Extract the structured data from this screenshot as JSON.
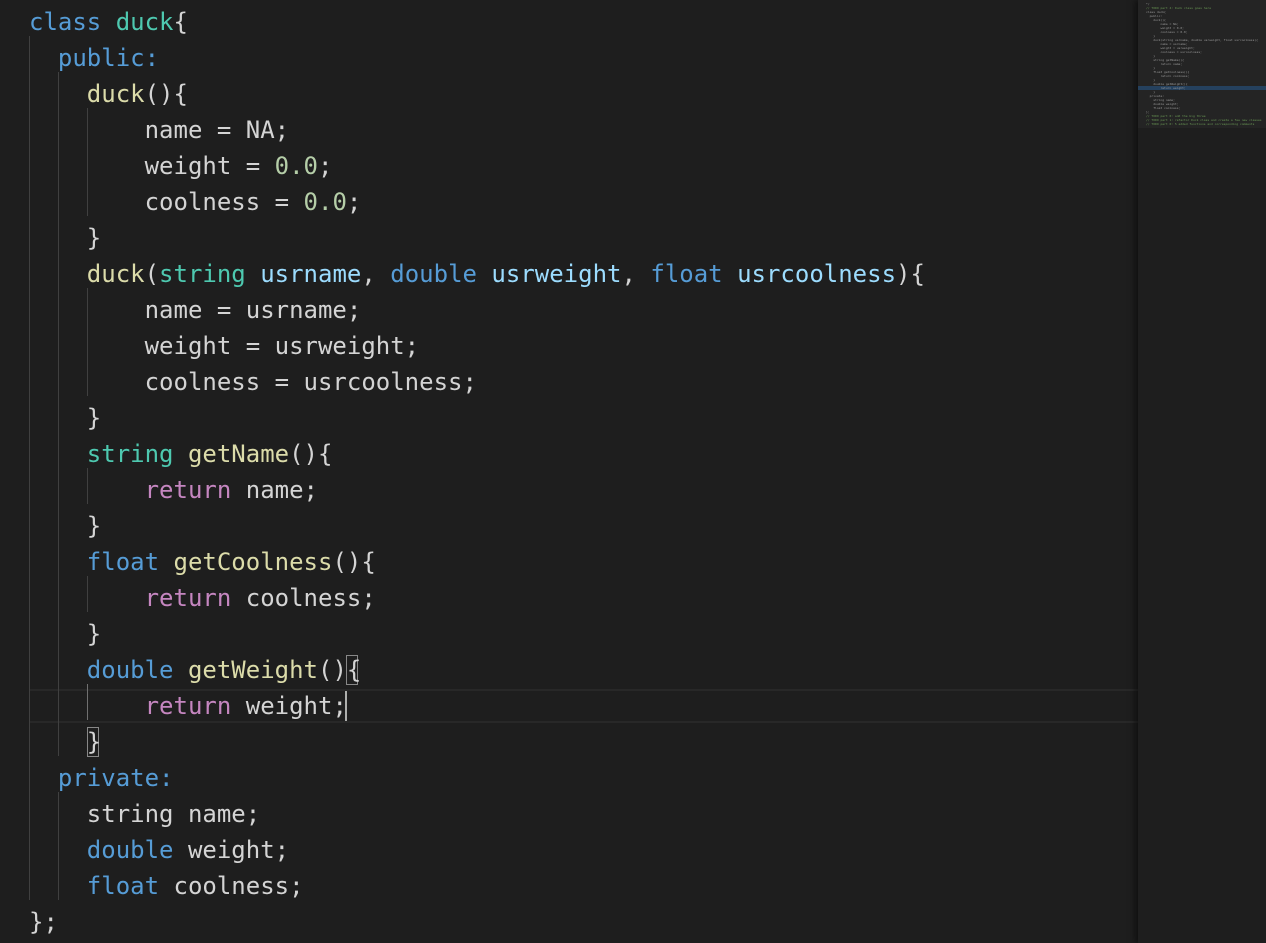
{
  "editor": {
    "lines": [
      [
        {
          "t": "class ",
          "c": "kw"
        },
        {
          "t": "duck",
          "c": "ty"
        },
        {
          "t": "{",
          "c": "pl"
        }
      ],
      [
        {
          "t": "  ",
          "c": "pl"
        },
        {
          "t": "public:",
          "c": "kw"
        }
      ],
      [
        {
          "t": "    ",
          "c": "pl"
        },
        {
          "t": "duck",
          "c": "fn"
        },
        {
          "t": "(){",
          "c": "pl"
        }
      ],
      [
        {
          "t": "        name = NA;",
          "c": "pl"
        }
      ],
      [
        {
          "t": "        weight = ",
          "c": "pl"
        },
        {
          "t": "0.0",
          "c": "num"
        },
        {
          "t": ";",
          "c": "pl"
        }
      ],
      [
        {
          "t": "        coolness = ",
          "c": "pl"
        },
        {
          "t": "0.0",
          "c": "num"
        },
        {
          "t": ";",
          "c": "pl"
        }
      ],
      [
        {
          "t": "    }",
          "c": "pl"
        }
      ],
      [
        {
          "t": "    ",
          "c": "pl"
        },
        {
          "t": "duck",
          "c": "fn"
        },
        {
          "t": "(",
          "c": "pl"
        },
        {
          "t": "string",
          "c": "ty"
        },
        {
          "t": " ",
          "c": "pl"
        },
        {
          "t": "usrname",
          "c": "prm"
        },
        {
          "t": ", ",
          "c": "pl"
        },
        {
          "t": "double",
          "c": "kw"
        },
        {
          "t": " ",
          "c": "pl"
        },
        {
          "t": "usrweight",
          "c": "prm"
        },
        {
          "t": ", ",
          "c": "pl"
        },
        {
          "t": "float",
          "c": "kw"
        },
        {
          "t": " ",
          "c": "pl"
        },
        {
          "t": "usrcoolness",
          "c": "prm"
        },
        {
          "t": "){",
          "c": "pl"
        }
      ],
      [
        {
          "t": "        name = usrname;",
          "c": "pl"
        }
      ],
      [
        {
          "t": "        weight = usrweight;",
          "c": "pl"
        }
      ],
      [
        {
          "t": "        coolness = usrcoolness;",
          "c": "pl"
        }
      ],
      [
        {
          "t": "    }",
          "c": "pl"
        }
      ],
      [
        {
          "t": "    ",
          "c": "pl"
        },
        {
          "t": "string",
          "c": "ty"
        },
        {
          "t": " ",
          "c": "pl"
        },
        {
          "t": "getName",
          "c": "fn"
        },
        {
          "t": "(){",
          "c": "pl"
        }
      ],
      [
        {
          "t": "        ",
          "c": "pl"
        },
        {
          "t": "return",
          "c": "ctl"
        },
        {
          "t": " name;",
          "c": "pl"
        }
      ],
      [
        {
          "t": "    }",
          "c": "pl"
        }
      ],
      [
        {
          "t": "    ",
          "c": "pl"
        },
        {
          "t": "float",
          "c": "kw"
        },
        {
          "t": " ",
          "c": "pl"
        },
        {
          "t": "getCoolness",
          "c": "fn"
        },
        {
          "t": "(){",
          "c": "pl"
        }
      ],
      [
        {
          "t": "        ",
          "c": "pl"
        },
        {
          "t": "return",
          "c": "ctl"
        },
        {
          "t": " coolness;",
          "c": "pl"
        }
      ],
      [
        {
          "t": "    }",
          "c": "pl"
        }
      ],
      [
        {
          "t": "    ",
          "c": "pl"
        },
        {
          "t": "double",
          "c": "kw"
        },
        {
          "t": " ",
          "c": "pl"
        },
        {
          "t": "getWeight",
          "c": "fn"
        },
        {
          "t": "(){",
          "c": "pl"
        }
      ],
      [
        {
          "t": "        ",
          "c": "pl"
        },
        {
          "t": "return",
          "c": "ctl"
        },
        {
          "t": " weight;",
          "c": "pl"
        }
      ],
      [
        {
          "t": "    }",
          "c": "pl"
        }
      ],
      [
        {
          "t": "  ",
          "c": "pl"
        },
        {
          "t": "private:",
          "c": "kw"
        }
      ],
      [
        {
          "t": "    string name;",
          "c": "pl"
        }
      ],
      [
        {
          "t": "    ",
          "c": "pl"
        },
        {
          "t": "double",
          "c": "kw"
        },
        {
          "t": " weight;",
          "c": "pl"
        }
      ],
      [
        {
          "t": "    ",
          "c": "pl"
        },
        {
          "t": "float",
          "c": "kw"
        },
        {
          "t": " coolness;",
          "c": "pl"
        }
      ],
      [
        {
          "t": "};",
          "c": "pl"
        }
      ]
    ],
    "cursor": {
      "line": 20,
      "column": 16
    }
  },
  "minimap": {
    "lines": [
      {
        "t": "*/",
        "c": "pl"
      },
      {
        "t": "// TODO part 4: Duck class goes here",
        "c": "comment"
      },
      {
        "t": "class duck{",
        "c": "pl"
      },
      {
        "t": "  public:",
        "c": "pl"
      },
      {
        "t": "    duck(){",
        "c": "pl"
      },
      {
        "t": "        name = NA;",
        "c": "pl"
      },
      {
        "t": "        weight = 0.0;",
        "c": "pl"
      },
      {
        "t": "        coolness = 0.0;",
        "c": "pl"
      },
      {
        "t": "    }",
        "c": "pl"
      },
      {
        "t": "    duck(string usrname, double usrweight, float usrcoolness){",
        "c": "pl"
      },
      {
        "t": "        name = usrname;",
        "c": "pl"
      },
      {
        "t": "        weight = usrweight;",
        "c": "pl"
      },
      {
        "t": "        coolness = usrcoolness;",
        "c": "pl"
      },
      {
        "t": "    }",
        "c": "pl"
      },
      {
        "t": "    string getName(){",
        "c": "pl"
      },
      {
        "t": "        return name;",
        "c": "pl"
      },
      {
        "t": "    }",
        "c": "pl"
      },
      {
        "t": "    float getCoolness(){",
        "c": "pl"
      },
      {
        "t": "        return coolness;",
        "c": "pl"
      },
      {
        "t": "    }",
        "c": "pl"
      },
      {
        "t": "    double getWeight(){",
        "c": "pl"
      },
      {
        "t": "        return weight;",
        "c": "pl"
      },
      {
        "t": "    }",
        "c": "pl"
      },
      {
        "t": "  private:",
        "c": "pl"
      },
      {
        "t": "    string name;",
        "c": "pl"
      },
      {
        "t": "    double weight;",
        "c": "pl"
      },
      {
        "t": "    float coolness;",
        "c": "pl"
      },
      {
        "t": "};",
        "c": "pl"
      },
      {
        "t": "// TODO part 0: add the big three",
        "c": "comment"
      },
      {
        "t": "// TODO part 1: refactor Duck class and create a few new classes",
        "c": "comment"
      },
      {
        "t": "// TODO part 0: 5 added functions and corresponding comments",
        "c": "comment"
      }
    ]
  }
}
